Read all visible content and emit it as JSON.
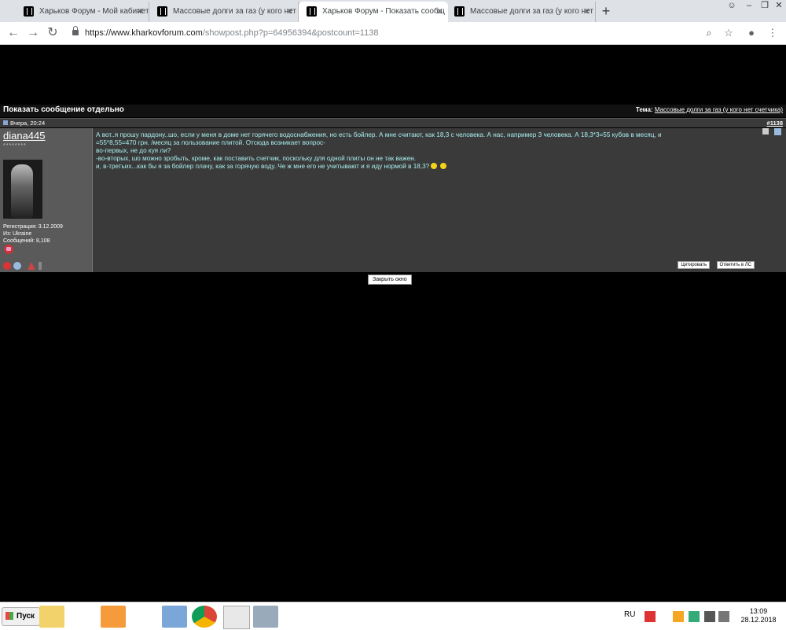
{
  "browser": {
    "tabs": [
      {
        "title": "Харьков Форум - Мой кабинет",
        "active": false
      },
      {
        "title": "Массовые долги за газ (у кого нет",
        "active": false
      },
      {
        "title": "Харьков Форум - Показать сообщ",
        "active": true
      },
      {
        "title": "Массовые долги за газ (у кого нет",
        "active": false
      }
    ],
    "url_host": "https://www.kharkovforum.com",
    "url_path": "/showpost.php?p=64956394&postcount=1138"
  },
  "post": {
    "header_title": "Показать сообщение отдельно",
    "theme_label": "Тема:",
    "theme_link": "Массовые долги за газ (у кого нет счетчика)",
    "date": "Вчера, 20:24",
    "post_number_prefix": "#",
    "post_number": "1138",
    "author": {
      "username": "diana445",
      "stars": "********",
      "registration": "Регистрация: 3.12.2009",
      "location": "Из: Ukraine",
      "posts": "Сообщений: 8,108"
    },
    "text_lines": [
      "А вот..я прошу пардону..шо, если у меня в доме нет горячего водоснабжения, но есть бойлер. А мне считают, как 18,3 с человека. А нас, например 3 человека. А 18,3*3=55 кубов в месяц, и",
      "=55*8,55=470 грн. /месяц за пользование плитой. Отсюда возникает вопрос-",
      "во-первых, не до куя ли?",
      "-во-вторых, шо можно зробыть, кроме, как поставить счетчик, поскольку для одной плиты он не так важен.",
      "и, в-третьих...как бы я за бойлер плачу, как за горячую воду..Че ж мне его не учитывают и я иду нормой в 18,3?"
    ],
    "quote_button": "Цитировать",
    "reply_pm_button": "Ответить в ЛС",
    "close_window_button": "Закрыть окно"
  },
  "taskbar": {
    "start_label": "Пуск",
    "language": "RU",
    "time": "13:09",
    "date": "28.12.2018"
  }
}
